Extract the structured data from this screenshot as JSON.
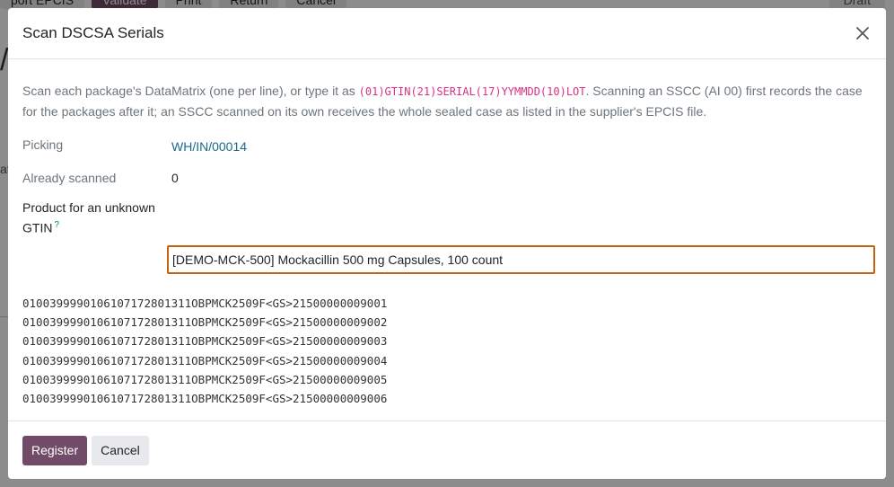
{
  "background": {
    "buttons": [
      "port EPCIS",
      "Validate",
      "Print",
      "Return",
      "Cancel"
    ],
    "status": "Draft",
    "title_fragment": "/",
    "label_fragment": "at"
  },
  "modal": {
    "title": "Scan DSCSA Serials",
    "help": {
      "before_code": "Scan each package's DataMatrix (one per line), or type it as ",
      "code": "(01)GTIN(21)SERIAL(17)YYMMDD(10)LOT",
      "after_code": ". Scanning an SSCC (AI 00) first records the case for the packages after it; an SSCC scanned on its own receives the whole sealed case as listed in the supplier's EPCIS file."
    },
    "fields": {
      "picking_label": "Picking",
      "picking_value": "WH/IN/00014",
      "scanned_label": "Already scanned",
      "scanned_value": "0",
      "product_label_line1": "Product for an unknown",
      "product_label_line2": "GTIN",
      "product_help_mark": "?",
      "product_value": "[DEMO-MCK-500] Mockacillin 500 mg Capsules, 100 count"
    },
    "serials": [
      "0100399990106107172801311OBPMCK2509F<GS>21500000009001",
      "0100399990106107172801311OBPMCK2509F<GS>21500000009002",
      "0100399990106107172801311OBPMCK2509F<GS>21500000009003",
      "0100399990106107172801311OBPMCK2509F<GS>21500000009004",
      "0100399990106107172801311OBPMCK2509F<GS>21500000009005",
      "0100399990106107172801311OBPMCK2509F<GS>21500000009006"
    ],
    "footer": {
      "register_label": "Register",
      "cancel_label": "Cancel"
    }
  }
}
